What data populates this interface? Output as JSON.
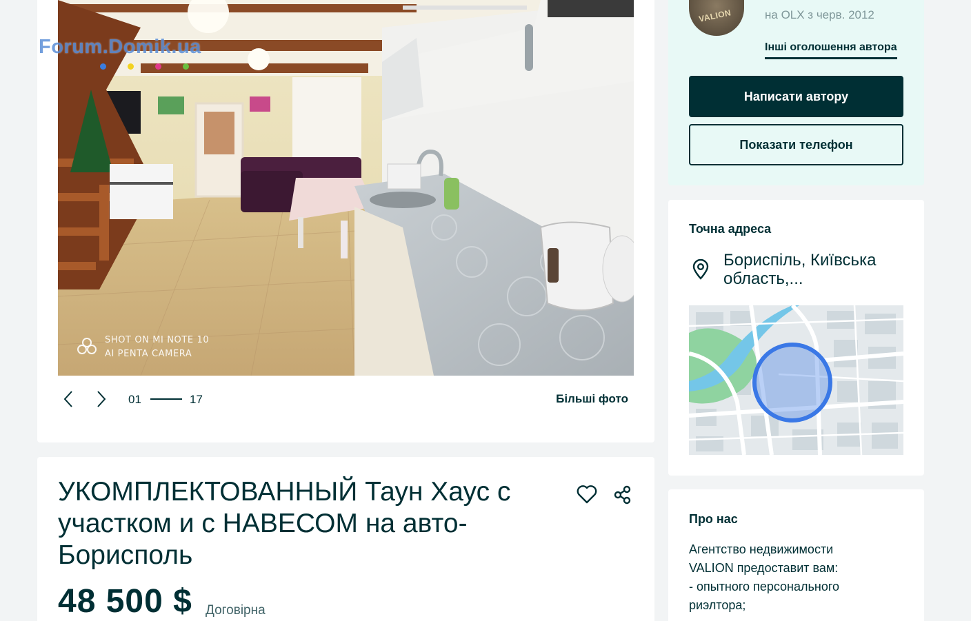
{
  "listing": {
    "title": "УКОМПЛЕКТОВАННЫЙ Таун Хаус с участком и с НАВЕСОМ на авто-Борисполь",
    "price": "48 500 $",
    "price_note": "Договірна"
  },
  "gallery": {
    "watermark": "Forum.Domik.ua",
    "camera_line1": "SHOT ON MI NOTE 10",
    "camera_line2": "AI PENTA CAMERA",
    "current": "01",
    "total": "17",
    "bigger_photos_label": "Більші фото"
  },
  "seller": {
    "avatar_text": "VALION",
    "member_since": "на OLX з черв. 2012",
    "other_ads_label": "Інші оголошення автора",
    "write_label": "Написати автору",
    "phone_label": "Показати телефон"
  },
  "address": {
    "heading": "Точна адреса",
    "text": "Бориспіль, Київська область,..."
  },
  "about": {
    "heading": "Про нас",
    "lines": [
      "Агентство недвижимости",
      "VALION предоставит вам:",
      "- опытного персонального",
      "риэлтора;"
    ]
  },
  "colors": {
    "primary": "#002f34",
    "seller_bg": "#e8f9f6",
    "page_bg": "#f2f4f5",
    "map_circle": "#3a78e6"
  },
  "icons": {
    "prev": "chevron-left-icon",
    "next": "chevron-right-icon",
    "favorite": "heart-icon",
    "share": "share-icon",
    "location": "map-pin-icon"
  }
}
